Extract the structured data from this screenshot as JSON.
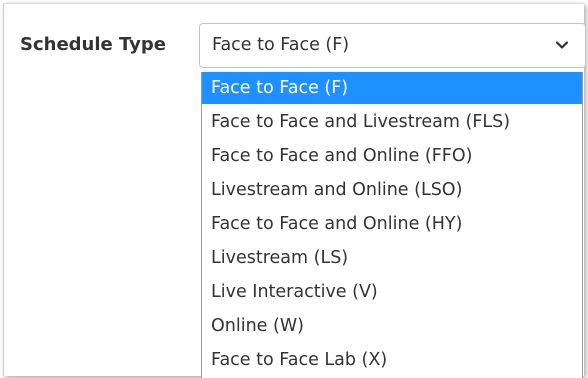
{
  "field": {
    "label": "Schedule Type",
    "selected_value": "Face to Face (F)",
    "chevron_icon": "chevron-down-icon"
  },
  "dropdown": {
    "highlight_color": "#1e90ff",
    "options": [
      {
        "label": "Face to Face (F)",
        "selected": true
      },
      {
        "label": "Face to Face and Livestream (FLS)",
        "selected": false
      },
      {
        "label": "Face to Face and Online (FFO)",
        "selected": false
      },
      {
        "label": "Livestream and Online (LSO)",
        "selected": false
      },
      {
        "label": "Face to Face and Online (HY)",
        "selected": false
      },
      {
        "label": "Livestream (LS)",
        "selected": false
      },
      {
        "label": "Live Interactive (V)",
        "selected": false
      },
      {
        "label": "Online (W)",
        "selected": false
      },
      {
        "label": "Face to Face Lab (X)",
        "selected": false
      }
    ]
  }
}
